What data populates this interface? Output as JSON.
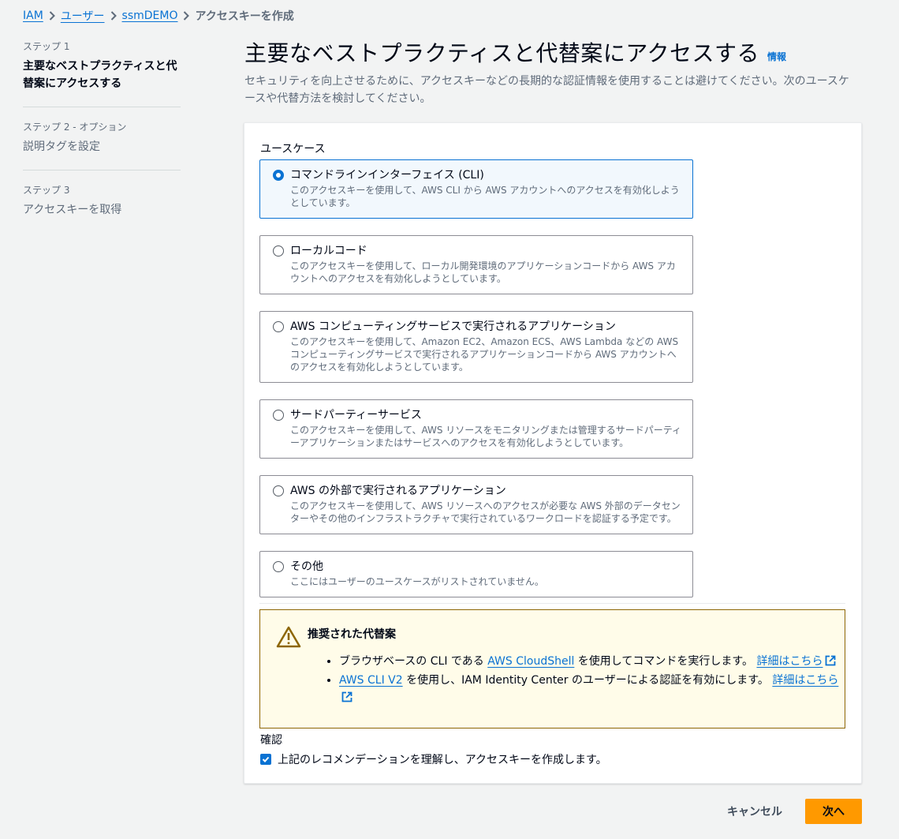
{
  "breadcrumb": {
    "items": [
      "IAM",
      "ユーザー",
      "ssmDEMO"
    ],
    "current": "アクセスキーを作成"
  },
  "sidebar": {
    "steps": [
      {
        "label": "ステップ 1",
        "title": "主要なベストプラクティスと代替案にアクセスする"
      },
      {
        "label": "ステップ 2 - オプション",
        "title": "説明タグを設定"
      },
      {
        "label": "ステップ 3",
        "title": "アクセスキーを取得"
      }
    ]
  },
  "header": {
    "title": "主要なベストプラクティスと代替案にアクセスする",
    "info": "情報",
    "description": "セキュリティを向上させるために、アクセスキーなどの長期的な認証情報を使用することは避けてください。次のユースケースや代替方法を検討してください。"
  },
  "use_case": {
    "label": "ユースケース",
    "options": [
      {
        "title": "コマンドラインインターフェイス (CLI)",
        "desc": "このアクセスキーを使用して、AWS CLI から AWS アカウントへのアクセスを有効化しようとしています。",
        "selected": true
      },
      {
        "title": "ローカルコード",
        "desc": "このアクセスキーを使用して、ローカル開発環境のアプリケーションコードから AWS アカウントへのアクセスを有効化しようとしています。",
        "selected": false
      },
      {
        "title": "AWS コンピューティングサービスで実行されるアプリケーション",
        "desc": "このアクセスキーを使用して、Amazon EC2、Amazon ECS、AWS Lambda などの AWS コンピューティングサービスで実行されるアプリケーションコードから AWS アカウントへのアクセスを有効化しようとしています。",
        "selected": false
      },
      {
        "title": "サードパーティーサービス",
        "desc": "このアクセスキーを使用して、AWS リソースをモニタリングまたは管理するサードパーティーアプリケーションまたはサービスへのアクセスを有効化しようとしています。",
        "selected": false
      },
      {
        "title": "AWS の外部で実行されるアプリケーション",
        "desc": "このアクセスキーを使用して、AWS リソースへのアクセスが必要な AWS 外部のデータセンターやその他のインフラストラクチャで実行されているワークロードを認証する予定です。",
        "selected": false
      },
      {
        "title": "その他",
        "desc": "ここにはユーザーのユースケースがリストされていません。",
        "selected": false
      }
    ]
  },
  "alert": {
    "title": "推奨された代替案",
    "item1_pre": "ブラウザベースの CLI である ",
    "item1_link": "AWS CloudShell",
    "item1_post": " を使用してコマンドを実行します。 ",
    "item1_more": "詳細はこちら",
    "item2_link": "AWS CLI V2",
    "item2_post": " を使用し、IAM Identity Center のユーザーによる認証を有効にします。 ",
    "item2_more": "詳細はこちら"
  },
  "confirm": {
    "label": "確認",
    "checkbox_text": "上記のレコメンデーションを理解し、アクセスキーを作成します。",
    "checked": true
  },
  "footer": {
    "cancel": "キャンセル",
    "next": "次へ"
  },
  "colors": {
    "accent": "#0972d3",
    "primary_button": "#ff9900",
    "warning_border": "#8d6605",
    "warning_bg": "#fffce9"
  }
}
